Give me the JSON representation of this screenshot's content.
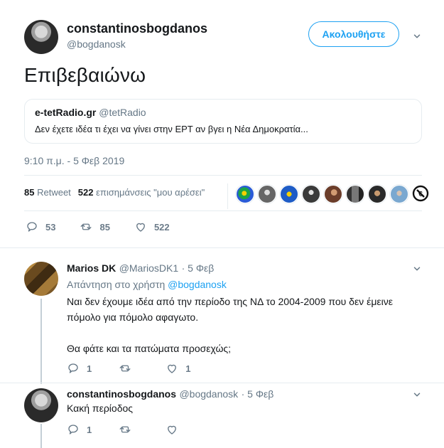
{
  "main_tweet": {
    "user": {
      "name": "constantinosbogdanos",
      "handle": "@bogdanosk"
    },
    "follow_button_label": "Ακολουθήστε",
    "text": "Επιβεβαιώνω",
    "quoted": {
      "name": "e-tetRadio.gr",
      "handle": "@tetRadio",
      "text": "Δεν έχετε ιδέα τι έχει να γίνει στην ΕΡΤ αν βγει η Νέα Δημοκρατία..."
    },
    "timestamp": "9:10 π.μ. - 5 Φεβ 2019",
    "stats": {
      "retweets_count": "85",
      "retweets_label": "Retweet",
      "likes_count": "522",
      "likes_label": "επισημάνσεις \"μου αρέσει\""
    },
    "actions": {
      "replies": "53",
      "retweets": "85",
      "likes": "522"
    }
  },
  "replies": [
    {
      "name": "Marios DK",
      "handle": "@MariosDK1",
      "time": "· 5 Φεβ",
      "reply_to_label": "Απάντηση στο χρήστη",
      "reply_to_handle": "@bogdanosk",
      "text_line1": "Ναι δεν έχουμε ιδέα από την περίοδο της ΝΔ το 2004-2009 που δεν έμεινε",
      "text_line2": "πόμολο για πόμολο αφαγωτο.",
      "text_line3": "Θα φάτε και τα πατώματα προσεχώς;",
      "actions": {
        "replies": "1",
        "retweets": "",
        "likes": "1"
      }
    },
    {
      "name": "constantinosbogdanos",
      "handle": "@bogdanosk",
      "time": "· 5 Φεβ",
      "text": "Κακή περίοδος",
      "actions": {
        "replies": "1",
        "retweets": "",
        "likes": ""
      }
    }
  ]
}
